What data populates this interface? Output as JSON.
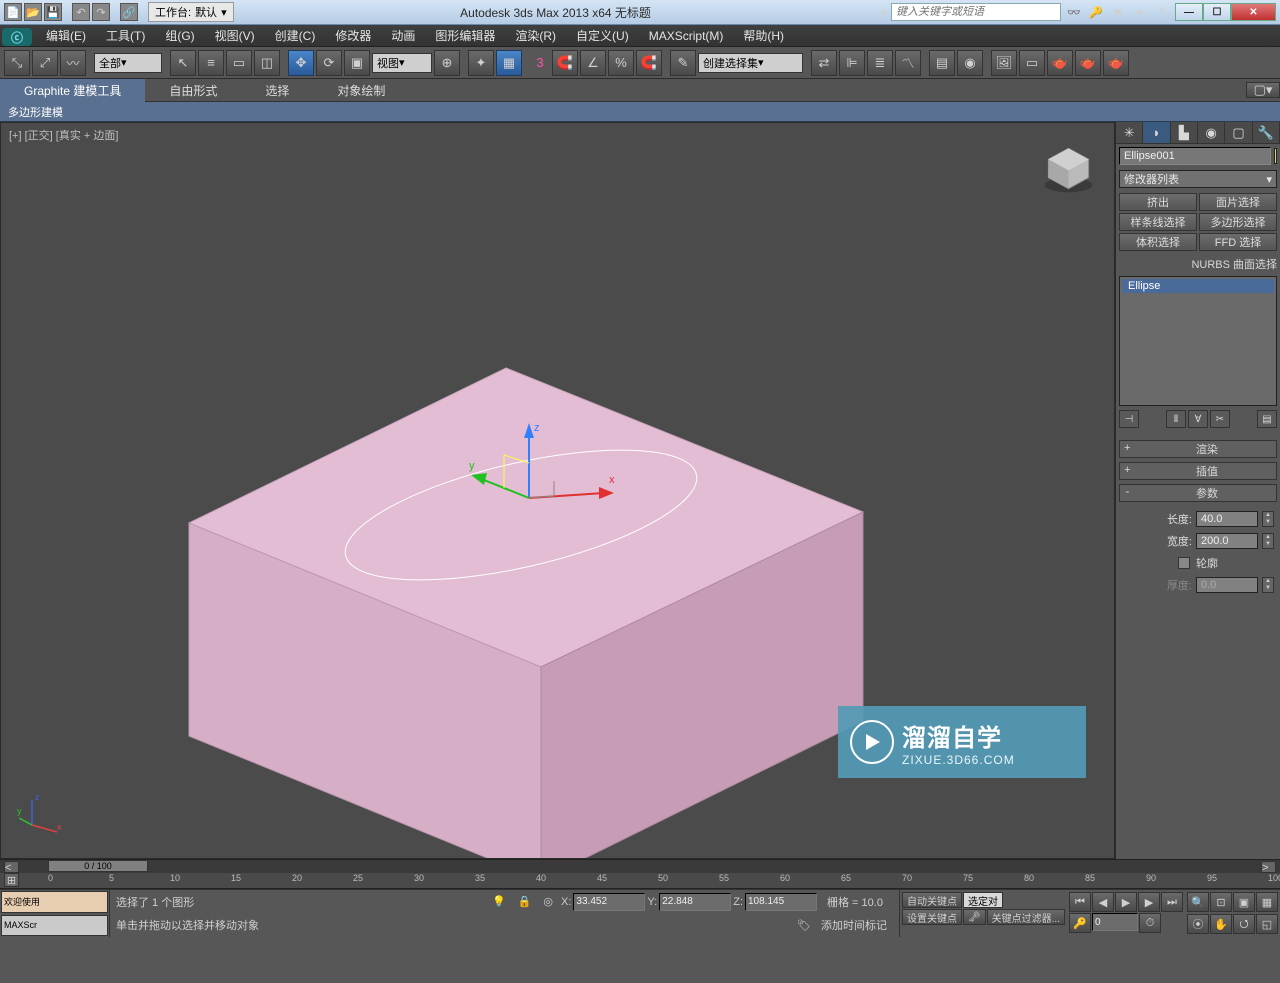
{
  "titlebar": {
    "workspace_prefix": "工作台:",
    "workspace_value": "默认",
    "app_title": "Autodesk 3ds Max  2013 x64     无标题",
    "search_placeholder": "键入关键字或短语"
  },
  "menu": [
    "编辑(E)",
    "工具(T)",
    "组(G)",
    "视图(V)",
    "创建(C)",
    "修改器",
    "动画",
    "图形编辑器",
    "渲染(R)",
    "自定义(U)",
    "MAXScript(M)",
    "帮助(H)"
  ],
  "toolbar": {
    "filter_dd": "全部",
    "view_dd": "视图",
    "named_sel": "创建选择集"
  },
  "ribbon": {
    "tabs": [
      "Graphite 建模工具",
      "自由形式",
      "选择",
      "对象绘制"
    ],
    "sub": "多边形建模"
  },
  "viewport": {
    "label": "[+] [正交] [真实 + 边面]"
  },
  "panel": {
    "object_name": "Ellipse001",
    "modifier_list": "修改器列表",
    "buttons": [
      "挤出",
      "面片选择",
      "样条线选择",
      "多边形选择",
      "体积选择",
      "FFD 选择"
    ],
    "nurbs": "NURBS 曲面选择",
    "stack_item": "Ellipse",
    "rollouts": {
      "render": "渲染",
      "interp": "插值",
      "params": "参数"
    },
    "params": {
      "length_label": "长度:",
      "length_value": "40.0",
      "width_label": "宽度:",
      "width_value": "200.0",
      "outline_label": "轮廓",
      "thickness_label": "厚度:",
      "thickness_value": "0.0"
    }
  },
  "timeline": {
    "slider": "0 / 100",
    "ticks": [
      "0",
      "5",
      "10",
      "15",
      "20",
      "25",
      "30",
      "35",
      "40",
      "45",
      "50",
      "55",
      "60",
      "65",
      "70",
      "75",
      "80",
      "85",
      "90",
      "95",
      "100"
    ]
  },
  "status": {
    "welcome": "欢迎使用",
    "maxscr": "MAXScr",
    "line1": "选择了 1 个图形",
    "line2": "单击并拖动以选择并移动对象",
    "x_label": "X:",
    "x_val": "33.452",
    "y_label": "Y:",
    "y_val": "22.848",
    "z_label": "Z:",
    "z_val": "108.145",
    "grid": "栅格 = 10.0",
    "add_time": "添加时间标记",
    "autokey": "自动关键点",
    "selected": "选定对",
    "setkey": "设置关键点",
    "keyfilter": "关键点过滤器...",
    "frame": "0"
  },
  "watermark": {
    "title": "溜溜自学",
    "url": "ZIXUE.3D66.COM"
  },
  "gizmo_labels": {
    "x": "x",
    "y": "y",
    "z": "z"
  }
}
